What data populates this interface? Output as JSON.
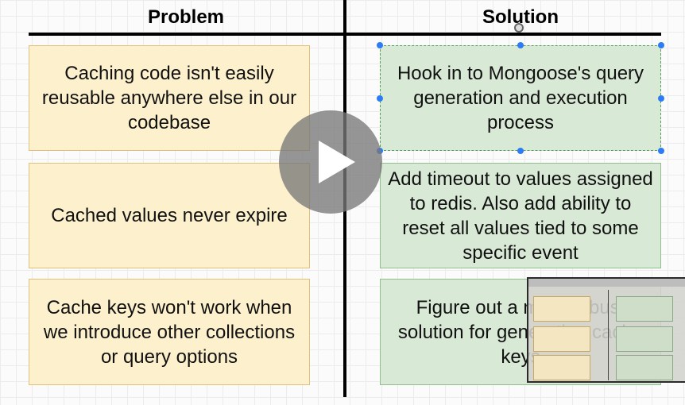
{
  "headers": {
    "problem": "Problem",
    "solution": "Solution"
  },
  "problems": [
    "Caching code isn't easily reusable anywhere else in our codebase",
    "Cached values never expire",
    "Cache keys won't work when we introduce other collections or query options"
  ],
  "solutions": [
    "Hook in to Mongoose's query generation and execution process",
    "Add timeout to values assigned to redis.  Also add ability to reset all values tied to some specific event",
    "Figure out a more robust solution for generating cache keys"
  ],
  "overlay": {
    "play_icon": "play-icon",
    "thumbnail": "video-thumbnail-preview"
  },
  "colors": {
    "problem_fill": "#fdf0cc",
    "problem_border": "#e0c07a",
    "solution_fill": "#d8e9d5",
    "solution_border": "#8fbf8a",
    "selection_handle": "#2d7cf6"
  }
}
